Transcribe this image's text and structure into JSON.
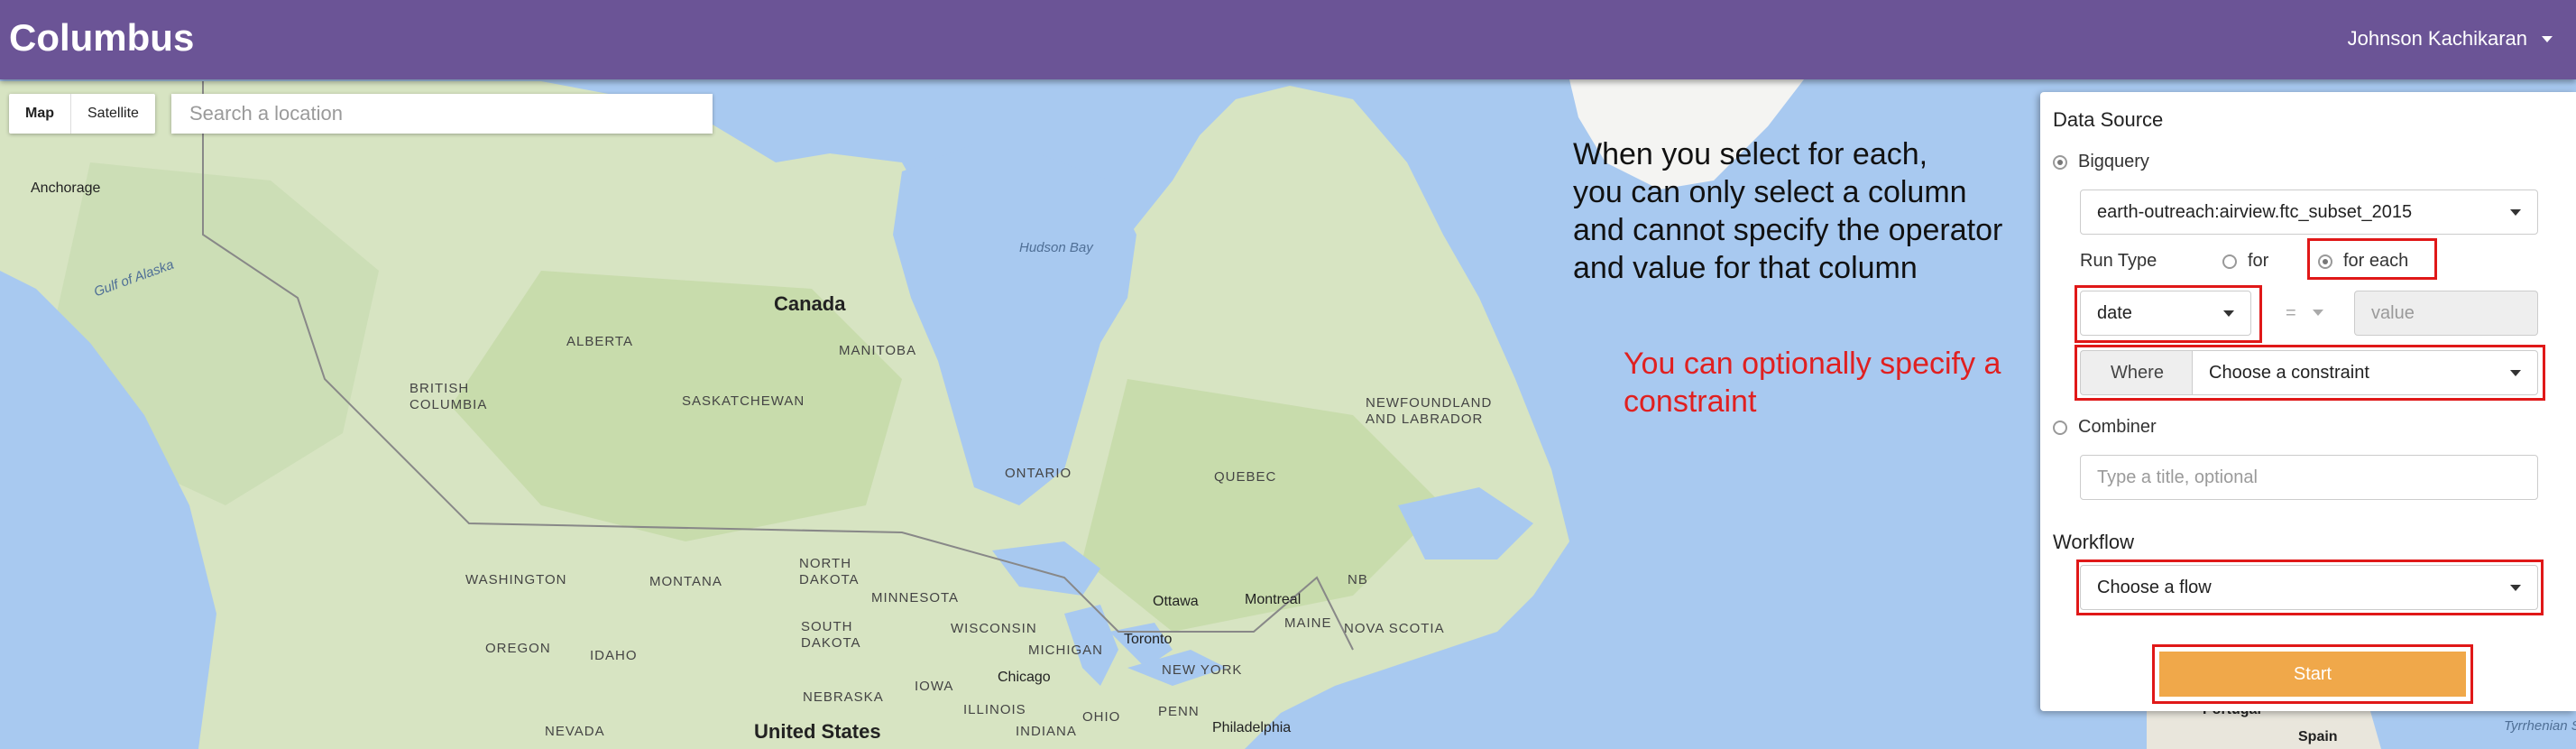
{
  "header": {
    "app_title": "Columbus",
    "user_name": "Johnson Kachikaran"
  },
  "map_controls": {
    "map_label": "Map",
    "satellite_label": "Satellite",
    "search_placeholder": "Search a location"
  },
  "map_labels": {
    "anchorage": "Anchorage",
    "gulf_of_alaska": "Gulf of Alaska",
    "hudson_bay": "Hudson Bay",
    "canada": "Canada",
    "alberta": "ALBERTA",
    "manitoba": "MANITOBA",
    "british_columbia": "BRITISH\nCOLUMBIA",
    "saskatchewan": "SASKATCHEWAN",
    "newfoundland": "NEWFOUNDLAND\nAND LABRADOR",
    "ontario": "ONTARIO",
    "quebec": "QUEBEC",
    "nb": "NB",
    "nova_scotia": "NOVA SCOTIA",
    "maine": "MAINE",
    "washington": "WASHINGTON",
    "montana": "MONTANA",
    "north_dakota": "NORTH\nDAKOTA",
    "minnesota": "MINNESOTA",
    "south_dakota": "SOUTH\nDAKOTA",
    "wisconsin": "WISCONSIN",
    "michigan": "MICHIGAN",
    "oregon": "OREGON",
    "idaho": "IDAHO",
    "nebraska": "NEBRASKA",
    "iowa": "IOWA",
    "illinois": "ILLINOIS",
    "indiana": "INDIANA",
    "ohio": "OHIO",
    "penn": "PENN",
    "new_york": "NEW YORK",
    "nevada": "NEVADA",
    "united_states": "United States",
    "ottawa": "Ottawa",
    "montreal": "Montreal",
    "toronto": "Toronto",
    "chicago": "Chicago",
    "philadelphia": "Philadelphia",
    "portugal": "Portugal",
    "spain": "Spain",
    "tyrrhenian": "Tyrrhenian S"
  },
  "annotations": {
    "for_each_note": "When you select for each,\nyou can only select a column\nand cannot specify the operator\nand value for that column",
    "constraint_note": "You can optionally specify a\nconstraint"
  },
  "panel": {
    "data_source_title": "Data Source",
    "bigquery_label": "Bigquery",
    "bigquery_selected": true,
    "table_value": "earth-outreach:airview.ftc_subset_2015",
    "run_type_label": "Run Type",
    "for_label": "for",
    "for_each_label": "for each",
    "run_type_selected": "for each",
    "column_value": "date",
    "operator_value": "=",
    "value_placeholder": "value",
    "where_label": "Where",
    "constraint_value": "Choose a constraint",
    "combiner_label": "Combiner",
    "combiner_selected": false,
    "title_placeholder": "Type a title, optional",
    "workflow_title": "Workflow",
    "flow_value": "Choose a flow",
    "start_label": "Start"
  },
  "colors": {
    "header_bg": "#6b5496",
    "start_button": "#f0a84a",
    "highlight_red": "#e01818",
    "annotation_red": "#e02020"
  }
}
